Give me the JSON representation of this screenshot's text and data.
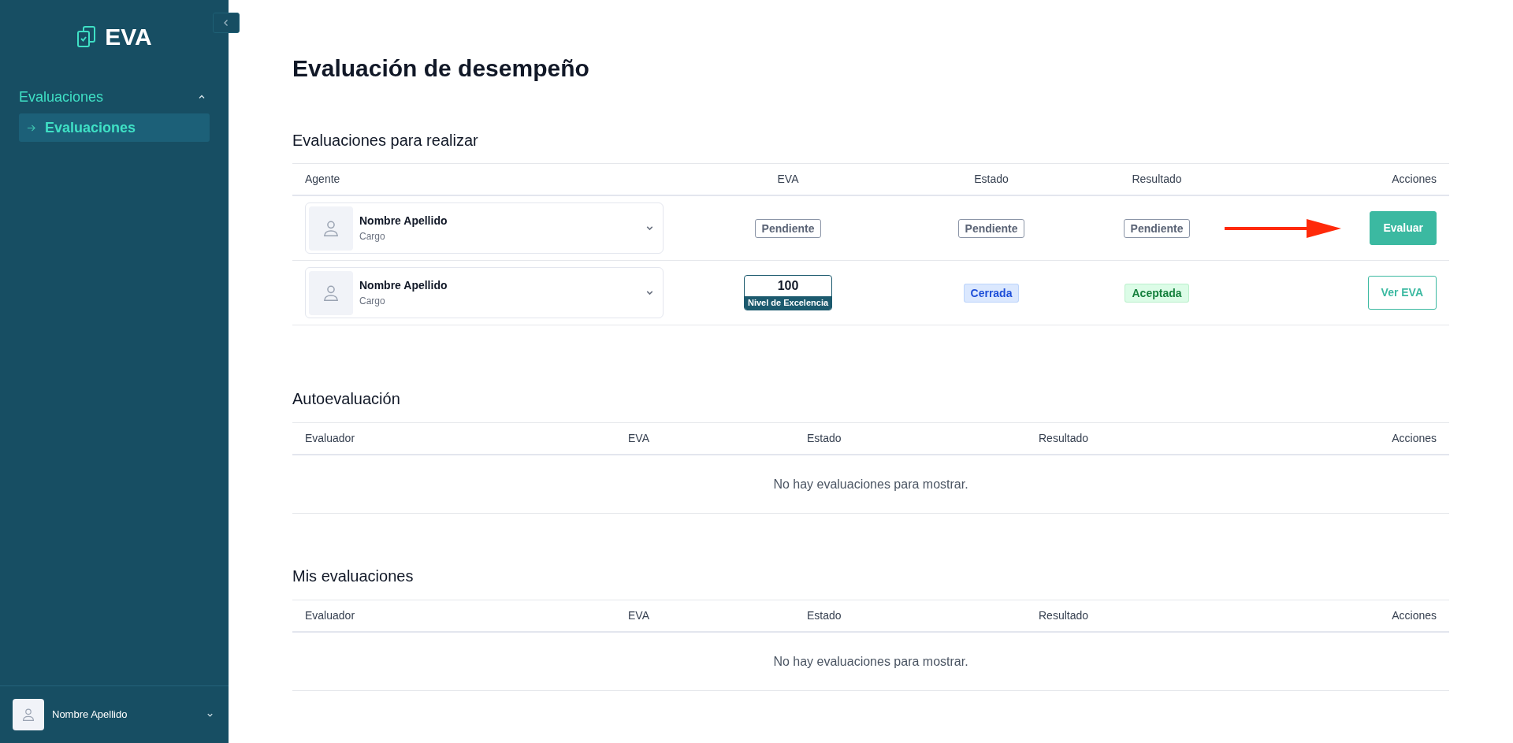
{
  "sidebar": {
    "logo": "EVA",
    "nav": [
      {
        "label": "Evaluaciones",
        "expanded": true,
        "children": [
          {
            "label": "Evaluaciones",
            "selected": true
          }
        ]
      }
    ],
    "user": {
      "name": "Nombre Apellido"
    }
  },
  "page": {
    "title": "Evaluación de desempeño"
  },
  "to_do": {
    "title": "Evaluaciones para realizar",
    "columns": [
      "Agente",
      "EVA",
      "Estado",
      "Resultado",
      "Acciones"
    ],
    "rows": [
      {
        "agent": {
          "name": "Nombre Apellido",
          "role": "Cargo"
        },
        "eva": {
          "kind": "badge",
          "text": "Pendiente"
        },
        "status": {
          "kind": "pending",
          "text": "Pendiente"
        },
        "result": {
          "kind": "pending",
          "text": "Pendiente"
        },
        "action": {
          "kind": "primary",
          "label": "Evaluar",
          "highlighted": true
        }
      },
      {
        "agent": {
          "name": "Nombre Apellido",
          "role": "Cargo"
        },
        "eva": {
          "kind": "score",
          "text": "100",
          "label": "Nivel de Excelencia"
        },
        "status": {
          "kind": "closed",
          "text": "Cerrada"
        },
        "result": {
          "kind": "accepted",
          "text": "Aceptada"
        },
        "action": {
          "kind": "secondary",
          "label": "Ver EVA",
          "highlighted": false
        }
      }
    ]
  },
  "self_evaluation": {
    "title": "Autoevaluación",
    "columns": [
      "Evaluador",
      "EVA",
      "Estado",
      "Resultado",
      "Acciones"
    ],
    "empty": "No hay evaluaciones para mostrar."
  },
  "my_evaluations": {
    "title": "Mis evaluaciones",
    "columns": [
      "Evaluador",
      "EVA",
      "Estado",
      "Resultado",
      "Acciones"
    ],
    "empty": "No hay evaluaciones para mostrar."
  }
}
